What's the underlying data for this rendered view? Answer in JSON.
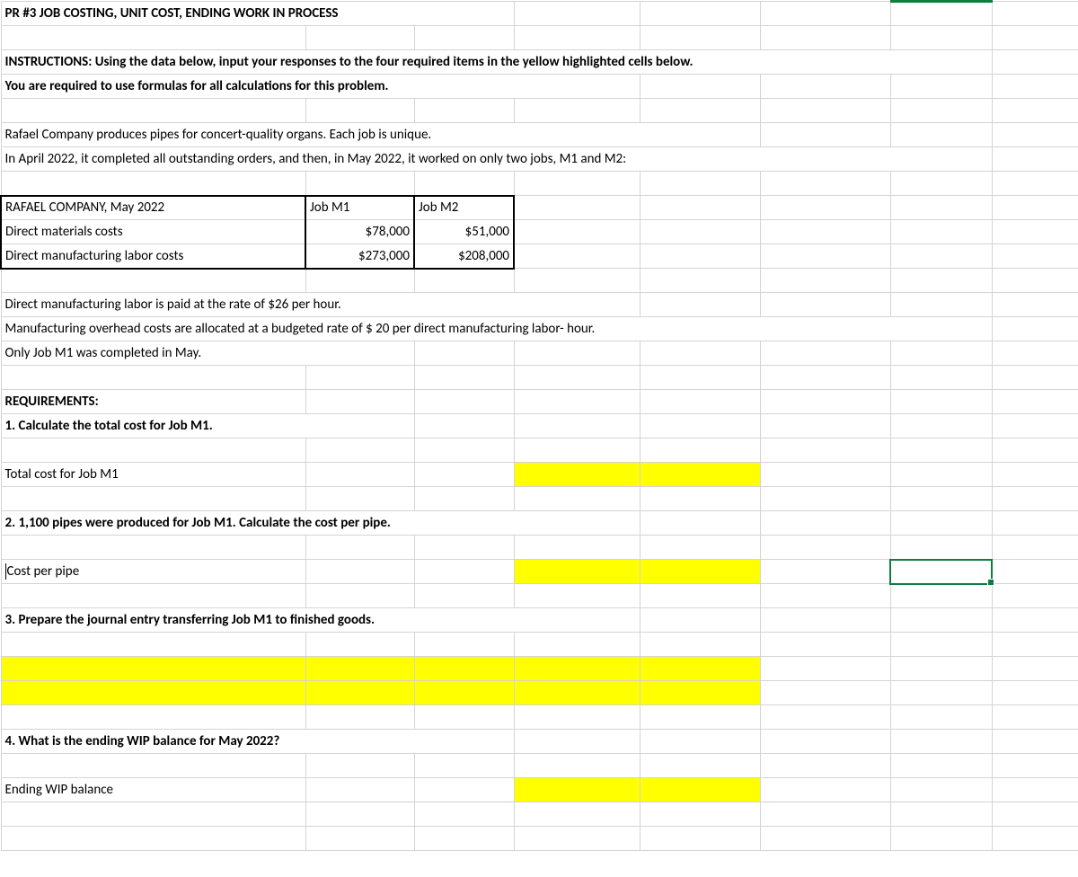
{
  "r1": {
    "title": "PR #3  JOB COSTING, UNIT COST, ENDING WORK IN PROCESS"
  },
  "r3": {
    "text": "INSTRUCTIONS:  Using the data below, input your responses to the four required items in the yellow highlighted cells below."
  },
  "r4": {
    "text": "You are required to use formulas for all calculations for this problem."
  },
  "r6": {
    "text": "Rafael Company produces pipes for concert-quality organs. Each job is unique."
  },
  "r7": {
    "text": " In April 2022, it completed all outstanding orders, and then, in May 2022, it worked on only two jobs, M1 and M2:"
  },
  "tbl": {
    "head_a": "RAFAEL COMPANY, May 2022",
    "head_b": "Job M1",
    "head_c": "Job M2",
    "row1_a": "Direct materials costs",
    "row1_b": "$78,000",
    "row1_c": "$51,000",
    "row2_a": "Direct manufacturing labor costs",
    "row2_b": "$273,000",
    "row2_c": "$208,000"
  },
  "r13": {
    "text": "Direct manufacturing labor is paid at the rate of $26 per hour."
  },
  "r14": {
    "text": "Manufacturing overhead costs are allocated at a budgeted rate of $ 20 per direct manufacturing labor- hour."
  },
  "r15": {
    "text": "Only Job M1 was completed in May."
  },
  "r17": {
    "text": "REQUIREMENTS:"
  },
  "r18": {
    "text": "1. Calculate the total cost for Job M1."
  },
  "r20": {
    "text": "Total cost for Job M1"
  },
  "r22": {
    "text": "2. 1,100 pipes were produced for Job M1. Calculate the cost per pipe."
  },
  "r24": {
    "text": "Cost per pipe"
  },
  "r26": {
    "text": "3. Prepare the journal entry transferring Job M1 to finished goods."
  },
  "r30": {
    "text": "4.  What is the ending WIP balance for May 2022?"
  },
  "r32": {
    "text": "Ending WIP balance"
  }
}
